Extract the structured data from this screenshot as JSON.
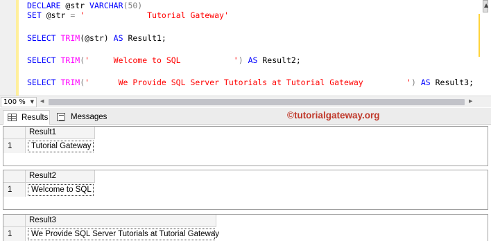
{
  "editor": {
    "line1": {
      "kw1": "DECLARE",
      "var": "@str",
      "type": "VARCHAR",
      "size": "(50)"
    },
    "line2": {
      "kw": "SET",
      "var": "@str",
      "eq": "=",
      "value": "'             Tutorial Gateway'"
    },
    "line3": {
      "kw1": "SELECT",
      "fn": "TRIM",
      "arg": "(@str)",
      "kw2": "AS",
      "alias": "Result1;"
    },
    "line4": {
      "kw1": "SELECT",
      "fn": "TRIM",
      "open": "(",
      "value": "'     Welcome to SQL           '",
      "close": ")",
      "kw2": "AS",
      "alias": "Result2;"
    },
    "line5": {
      "kw1": "SELECT",
      "fn": "TRIM",
      "open": "(",
      "value": "'      We Provide SQL Server Tutorials at Tutorial Gateway         '",
      "close": ")",
      "kw2": "AS",
      "alias": "Result3;"
    }
  },
  "zoom": {
    "level": "100 %"
  },
  "tabs": {
    "results": "Results",
    "messages": "Messages"
  },
  "watermark": "©tutorialgateway.org",
  "grids": [
    {
      "header": "Result1",
      "row": "1",
      "value": "Tutorial Gateway"
    },
    {
      "header": "Result2",
      "row": "1",
      "value": "Welcome to SQL"
    },
    {
      "header": "Result3",
      "row": "1",
      "value": "We Provide SQL Server Tutorials at Tutorial Gateway"
    }
  ],
  "colors": {
    "keyword": "#0000ff",
    "function": "#ff00ff",
    "string": "#ff0000",
    "watermark": "#c0392b"
  }
}
